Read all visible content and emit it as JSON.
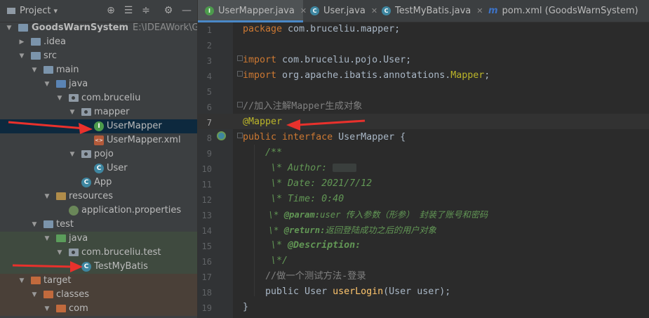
{
  "project_panel": {
    "title": "Project",
    "tree": [
      {
        "label": "GoodsWarnSystem",
        "path": "E:\\IDEAWork\\Good"
      },
      {
        "label": ".idea"
      },
      {
        "label": "src"
      },
      {
        "label": "main"
      },
      {
        "label": "java"
      },
      {
        "label": "com.bruceliu"
      },
      {
        "label": "mapper"
      },
      {
        "label": "UserMapper"
      },
      {
        "label": "UserMapper.xml"
      },
      {
        "label": "pojo"
      },
      {
        "label": "User"
      },
      {
        "label": "App"
      },
      {
        "label": "resources"
      },
      {
        "label": "application.properties"
      },
      {
        "label": "test"
      },
      {
        "label": "java"
      },
      {
        "label": "com.bruceliu.test"
      },
      {
        "label": "TestMyBatis"
      },
      {
        "label": "target"
      },
      {
        "label": "classes"
      },
      {
        "label": "com"
      }
    ]
  },
  "tabs": [
    {
      "label": "UserMapper.java",
      "icon": "interface-icon"
    },
    {
      "label": "User.java",
      "icon": "class-icon"
    },
    {
      "label": "TestMyBatis.java",
      "icon": "test-class-icon"
    },
    {
      "label": "pom.xml (GoodsWarnSystem)",
      "icon": "maven-icon"
    }
  ],
  "editor": {
    "line_numbers": [
      "1",
      "2",
      "3",
      "4",
      "5",
      "6",
      "7",
      "8",
      "9",
      "10",
      "11",
      "12",
      "13",
      "14",
      "15",
      "16",
      "17",
      "18",
      "19"
    ],
    "current_line": "7",
    "tokens": {
      "l1_kw": "package",
      "l1_rest": " com.bruceliu.mapper;",
      "l3_kw": "import",
      "l3_rest": " com.bruceliu.pojo.User;",
      "l4_kw": "import",
      "l4_rest": " org.apache.ibatis.annotations.",
      "l4_ann": "Mapper",
      "l4_end": ";",
      "l6": "//加入注解Mapper生成对象",
      "l7": "@Mapper",
      "l8_kw": "public interface",
      "l8_rest": " UserMapper {",
      "l9": "    /**",
      "l10": "     \\* Author: ",
      "l11": "     \\* Date: 2021/7/12",
      "l12": "     \\* Time: 0:40",
      "l13_a": "     \\* ",
      "l13_tag": "@param:",
      "l13_b": "user 传入参数（形参） 封装了账号和密码",
      "l14_a": "     \\* ",
      "l14_tag": "@return:",
      "l14_b": "返回登陆成功之后的用户对象",
      "l15_a": "     \\* ",
      "l15_tag": "@Description:",
      "l16": "     \\*/",
      "l17": "    //做一个测试方法-登录",
      "l18_a": "    public User ",
      "l18_m": "userLogin",
      "l18_b": "(User user);",
      "l19": "}"
    }
  },
  "colors": {
    "keyword": "#cc7832",
    "annotation": "#bbb529",
    "comment": "#808080",
    "doc_comment": "#629755",
    "method": "#ffc66d",
    "arrow": "#e8312c",
    "selection": "#0d293e"
  }
}
